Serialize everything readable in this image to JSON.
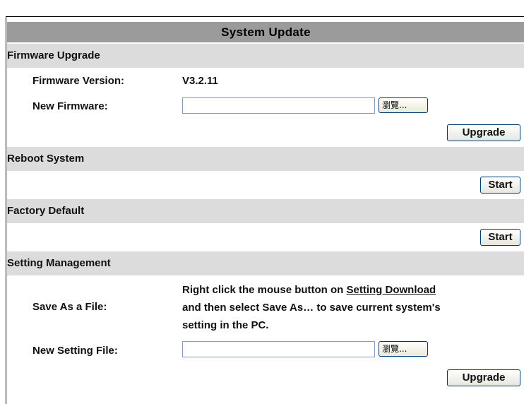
{
  "title": "System Update",
  "firmware_upgrade": {
    "heading": "Firmware Upgrade",
    "version_label": "Firmware Version:",
    "version_value": "V3.2.11",
    "new_firmware_label": "New Firmware:",
    "new_firmware_value": "",
    "browse_label": "瀏覽...",
    "upgrade_label": "Upgrade"
  },
  "reboot_system": {
    "heading": "Reboot System",
    "start_label": "Start"
  },
  "factory_default": {
    "heading": "Factory Default",
    "start_label": "Start"
  },
  "setting_management": {
    "heading": "Setting Management",
    "save_label": "Save As a File:",
    "instruction_prefix": "Right click the mouse button on ",
    "download_link": "Setting Download",
    "instruction_line2": "and then select Save As… to save current system's",
    "instruction_line3": "setting in the PC.",
    "new_setting_label": "New Setting File:",
    "new_setting_value": "",
    "browse_label": "瀏覽...",
    "upgrade_label": "Upgrade"
  }
}
